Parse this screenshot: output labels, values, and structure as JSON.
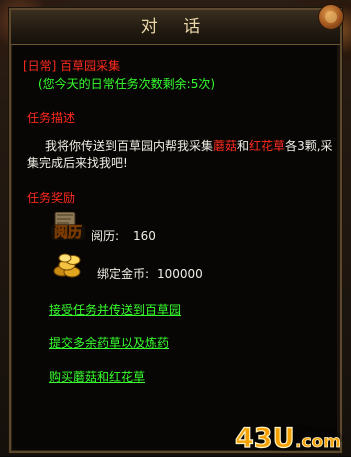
{
  "window": {
    "title": "对 话"
  },
  "quest": {
    "header": "[日常] 百草园采集",
    "remaining": "(您今天的日常任务次数剩余:5次)",
    "desc_title": "任务描述",
    "desc": {
      "part1": "我将你传送到百草园内帮我采集",
      "item1": "蘑菇",
      "part2": "和",
      "item2": "红花草",
      "part3": "各3颗,采集完成后来找我吧!"
    },
    "reward_title": "任务奖励",
    "rewards": [
      {
        "icon_text": "阅历",
        "label": "阅历:",
        "value": "160"
      },
      {
        "icon": "gold-coins-icon",
        "label": "绑定金币:",
        "value": "100000"
      }
    ],
    "actions": [
      "接受任务并传送到百草园",
      "提交多余药草以及炼药",
      "购买蘑菇和红花草"
    ]
  },
  "branding": {
    "logo_text": "43U",
    "logo_sub": ".com"
  },
  "colors": {
    "quest_red": "#ff2a1f",
    "action_green": "#37ff2e",
    "title_gold": "#e9d6a8",
    "frame_border": "#5d4a2e",
    "logo_orange": "#f5a000"
  }
}
